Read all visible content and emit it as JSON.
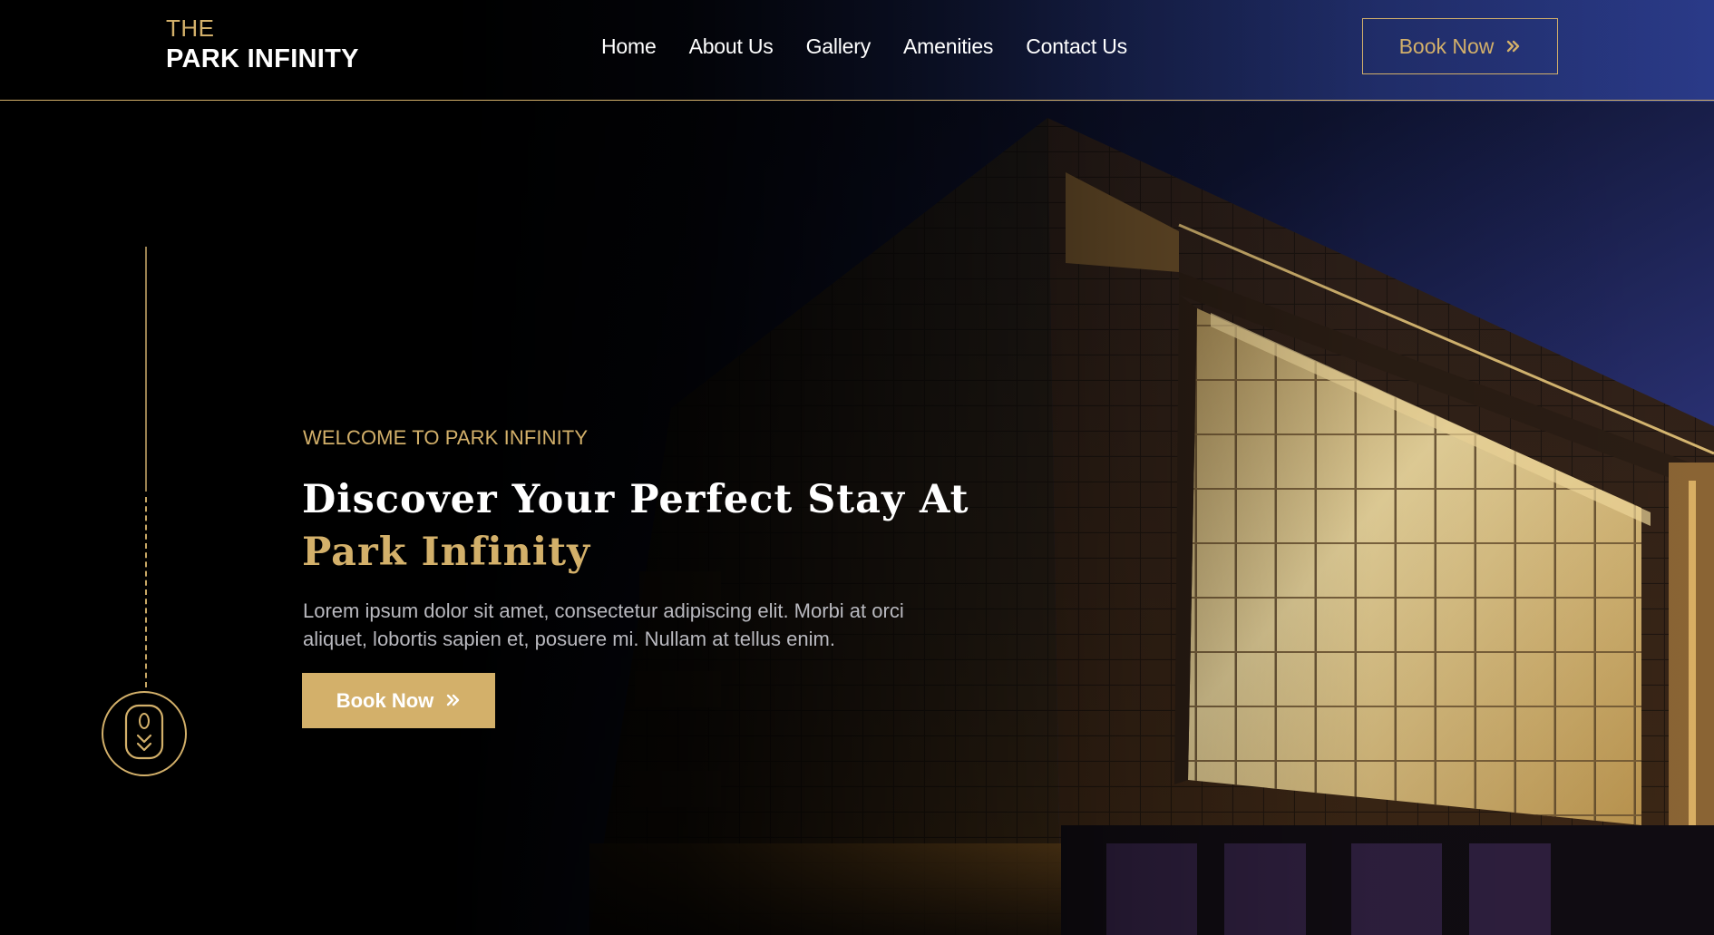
{
  "brand": {
    "the": "THE",
    "name": "PARK INFINITY"
  },
  "nav": {
    "home": "Home",
    "about": "About Us",
    "gallery": "Gallery",
    "amenities": "Amenities",
    "contact": "Contact Us"
  },
  "header": {
    "book_label": "Book Now"
  },
  "hero": {
    "eyebrow": "WELCOME TO PARK INFINITY",
    "title_line1": "Discover Your Perfect Stay At",
    "title_line2": "Park Infinity",
    "description_line1": "Lorem ipsum dolor sit amet, consectetur adipiscing elit. Morbi at orci",
    "description_line2": "aliquet, lobortis sapien et, posuere mi. Nullam at tellus enim.",
    "book_label": "Book Now"
  },
  "colors": {
    "accent": "#d3b06a",
    "background": "#05060d"
  },
  "icons": {
    "book_arrow": "double-chevron-right-icon",
    "scroll": "mouse-scroll-icon"
  }
}
